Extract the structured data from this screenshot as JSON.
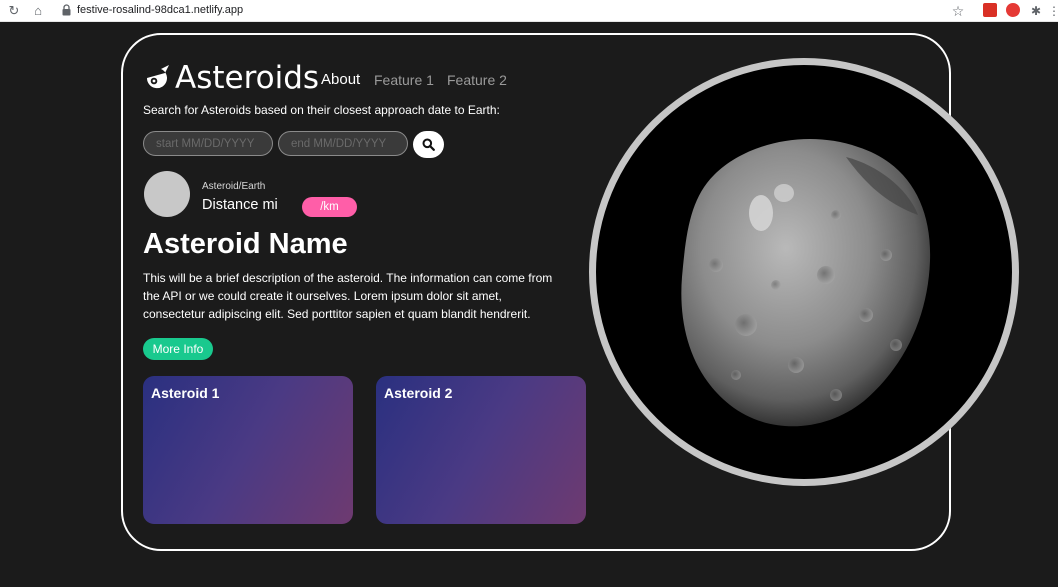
{
  "browser": {
    "url": "festive-rosalind-98dca1.netlify.app"
  },
  "header": {
    "logo_text": "Asteroids",
    "nav": [
      "About",
      "Feature 1",
      "Feature 2"
    ]
  },
  "search": {
    "label": "Search for Asteroids based on their closest approach date to Earth:",
    "start_placeholder": "start MM/DD/YYYY",
    "end_placeholder": "end MM/DD/YYYY",
    "button_icon": "search-icon"
  },
  "stats": {
    "label": "Asteroid/Earth",
    "distance": "Distance mi",
    "unit_toggle": "/km"
  },
  "asteroid": {
    "name": "Asteroid Name",
    "description": "This will be a brief description of the asteroid. The information can come from the API or we could create it ourselves. Lorem ipsum dolor sit amet, consectetur adipiscing elit. Sed porttitor sapien et quam blandit hendrerit.",
    "more_button": "More Info"
  },
  "cards": [
    {
      "title": "Asteroid 1"
    },
    {
      "title": "Asteroid 2"
    }
  ],
  "colors": {
    "background": "#1b1b1b",
    "accent_pink": "#ff5ea8",
    "accent_green": "#19c98e",
    "card_gradient_start": "#2a3080",
    "card_gradient_end": "#6e3a70"
  }
}
